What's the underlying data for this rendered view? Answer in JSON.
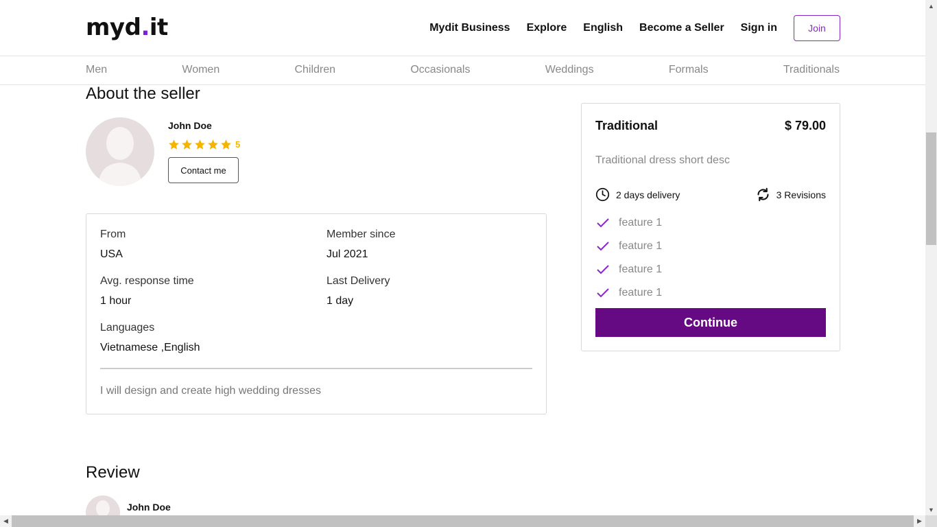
{
  "header": {
    "logo_main": "myd",
    "logo_dot": ".",
    "logo_end": "it",
    "nav": [
      "Mydit Business",
      "Explore",
      "English",
      "Become a Seller",
      "Sign in"
    ],
    "join_label": "Join"
  },
  "categories": [
    "Men",
    "Women",
    "Children",
    "Occasionals",
    "Weddings",
    "Formals",
    "Traditionals"
  ],
  "about": {
    "title": "About the seller",
    "seller_name": "John Doe",
    "rating": "5",
    "stars": 5,
    "contact_label": "Contact me",
    "from_label": "From",
    "from_value": "USA",
    "member_label": "Member since",
    "member_value": "Jul 2021",
    "response_label": "Avg. response time",
    "response_value": "1 hour",
    "delivery_label": "Last Delivery",
    "delivery_value": "1 day",
    "languages_label": "Languages",
    "languages_value": "Vietnamese ,English",
    "description": "I will design and create high wedding dresses"
  },
  "package": {
    "title": "Traditional",
    "price": "$ 79.00",
    "description": "Traditional dress short desc",
    "delivery": "2 days delivery",
    "revisions": "3 Revisions",
    "features": [
      "feature 1",
      "feature 1",
      "feature 1",
      "feature 1"
    ],
    "continue_label": "Continue"
  },
  "review": {
    "title": "Review",
    "reviewer_name": "John Doe"
  },
  "colors": {
    "accent": "#8a25c9",
    "button": "#650a82",
    "star": "#f5b400"
  }
}
